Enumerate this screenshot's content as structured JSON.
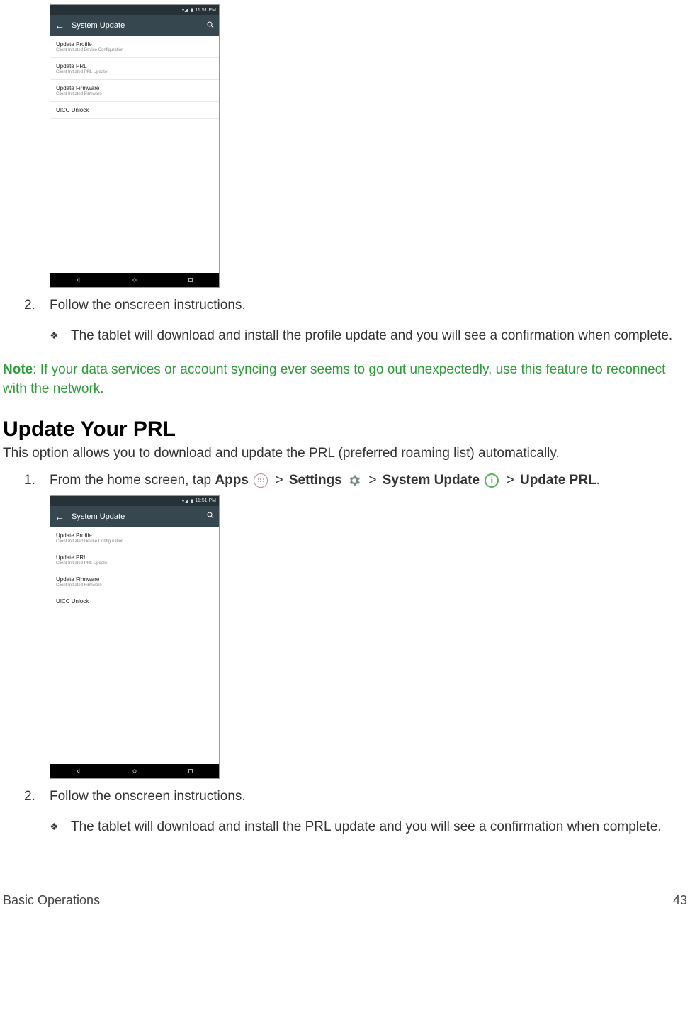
{
  "screenshot": {
    "status_time": "11:51 PM",
    "title": "System Update",
    "items": [
      {
        "t": "Update Profile",
        "s": "Client Initiated Device Configuration"
      },
      {
        "t": "Update PRL",
        "s": "Client Initiated PRL Update"
      },
      {
        "t": "Update Firmware",
        "s": "Client Initiated Firmware"
      },
      {
        "t": "UICC Unlock",
        "s": ""
      }
    ]
  },
  "sec1": {
    "step2_num": "2.",
    "step2_text": "Follow the onscreen instructions.",
    "bullet_text": "The tablet will download and install the profile update and you will see a confirmation when complete."
  },
  "note": {
    "label": "Note",
    "text": ": If your data services or account syncing ever seems to go out unexpectedly, use this feature to reconnect with the network."
  },
  "sec2": {
    "heading": "Update Your PRL",
    "desc": "This option allows you to download and update the PRL (preferred roaming list) automatically.",
    "step1_num": "1.",
    "step1_a": "From the home screen, tap ",
    "step1_apps": "Apps",
    "step1_settings": "Settings",
    "step1_sysupdate": "System Update",
    "step1_updateprl": "Update PRL",
    "gt": ">",
    "period": ".",
    "step2_num": "2.",
    "step2_text": "Follow the onscreen instructions.",
    "bullet_text": "The tablet will download and install the PRL update and you will see a confirmation when complete."
  },
  "footer": {
    "left": "Basic Operations",
    "right": "43"
  },
  "glyphs": {
    "bullet": "❖",
    "info": "i"
  }
}
